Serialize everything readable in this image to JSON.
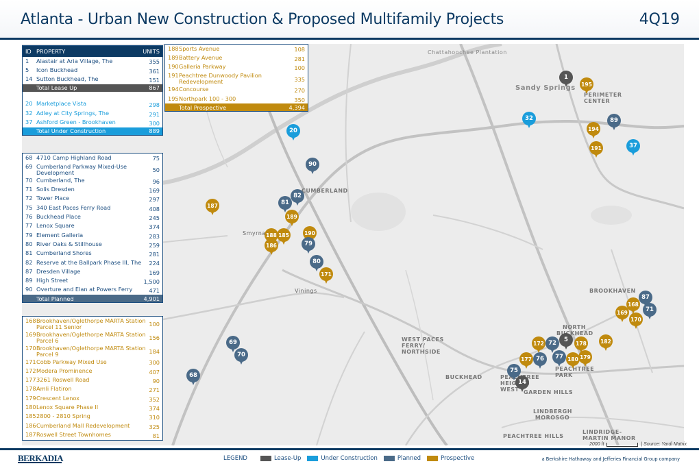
{
  "header": {
    "title": "Atlanta - Urban New Construction & Proposed Multifamily Projects",
    "quarter": "4Q19"
  },
  "table": {
    "columns": {
      "id": "ID",
      "property": "PROPERTY",
      "units": "UNITS"
    },
    "lease_up": {
      "rows": [
        {
          "id": "1",
          "name": "Alastair at Aria Village, The",
          "units": "355"
        },
        {
          "id": "5",
          "name": "Icon Buckhead",
          "units": "361"
        },
        {
          "id": "14",
          "name": "Sutton Buckhead, The",
          "units": "151"
        }
      ],
      "total_label": "Total Lease Up",
      "total": "867"
    },
    "under_construction": {
      "rows": [
        {
          "id": "20",
          "name": "Marketplace Vista",
          "units": "298"
        },
        {
          "id": "32",
          "name": "Adley at City Springs, The",
          "units": "291"
        },
        {
          "id": "37",
          "name": "Ashford Green - Brookhaven",
          "units": "300"
        }
      ],
      "total_label": "Total Under Construction",
      "total": "889"
    },
    "planned": {
      "rows": [
        {
          "id": "68",
          "name": "4710 Camp Highland Road",
          "units": "75"
        },
        {
          "id": "69",
          "name": "Cumberland Parkway Mixed-Use Development",
          "units": "50"
        },
        {
          "id": "70",
          "name": "Cumberland, The",
          "units": "96"
        },
        {
          "id": "71",
          "name": "Solis Dresden",
          "units": "169"
        },
        {
          "id": "72",
          "name": "Tower Place",
          "units": "297"
        },
        {
          "id": "75",
          "name": "340 East Paces Ferry Road",
          "units": "408"
        },
        {
          "id": "76",
          "name": "Buckhead Place",
          "units": "245"
        },
        {
          "id": "77",
          "name": "Lenox Square",
          "units": "374"
        },
        {
          "id": "79",
          "name": "Element Galleria",
          "units": "283"
        },
        {
          "id": "80",
          "name": "River Oaks & Stillhouse",
          "units": "259"
        },
        {
          "id": "81",
          "name": "Cumberland Shores",
          "units": "281"
        },
        {
          "id": "82",
          "name": "Reserve at the Ballpark Phase III, The",
          "units": "224"
        },
        {
          "id": "87",
          "name": "Dresden Village",
          "units": "169"
        },
        {
          "id": "89",
          "name": "High Street",
          "units": "1,500"
        },
        {
          "id": "90",
          "name": "Overture and Elan at Powers Ferry",
          "units": "471"
        }
      ],
      "total_label": "Total Planned",
      "total": "4,901"
    },
    "prospective": {
      "rows": [
        {
          "id": "168",
          "name": "Brookhaven/Oglethorpe MARTA Station Parcel 11 Senior",
          "units": "100"
        },
        {
          "id": "169",
          "name": "Brookhaven/Oglethorpe MARTA Station Parcel 6",
          "units": "156"
        },
        {
          "id": "170",
          "name": "Brookhaven/Oglethorpe MARTA Station Parcel 9",
          "units": "184"
        },
        {
          "id": "171",
          "name": "Cobb Parkway Mixed Use",
          "units": "300"
        },
        {
          "id": "172",
          "name": "Modera Prominence",
          "units": "407"
        },
        {
          "id": "177",
          "name": "3261 Roswell Road",
          "units": "90"
        },
        {
          "id": "178",
          "name": "Amli Flatiron",
          "units": "271"
        },
        {
          "id": "179",
          "name": "Crescent Lenox",
          "units": "352"
        },
        {
          "id": "180",
          "name": "Lenox Square Phase II",
          "units": "374"
        },
        {
          "id": "185",
          "name": "2800 - 2810 Spring",
          "units": "310"
        },
        {
          "id": "186",
          "name": "Cumberland Mall Redevelopment",
          "units": "325"
        },
        {
          "id": "187",
          "name": "Roswell Street Townhomes",
          "units": "81"
        }
      ]
    },
    "prospective_cont": {
      "rows": [
        {
          "id": "188",
          "name": "Sports Avenue",
          "units": "108"
        },
        {
          "id": "189",
          "name": "Battery Avenue",
          "units": "281"
        },
        {
          "id": "190",
          "name": "Galleria Parkway",
          "units": "100"
        },
        {
          "id": "191",
          "name": "Peachtree Dunwoody Pavilion Redevelopment",
          "units": "335"
        },
        {
          "id": "194",
          "name": "Concourse",
          "units": "270"
        },
        {
          "id": "195",
          "name": "Northpark 100 - 300",
          "units": "350"
        }
      ],
      "total_label": "Total Prospective",
      "total": "4,394"
    }
  },
  "map": {
    "labels": [
      {
        "text": "Chattahoochee Plantation"
      },
      {
        "text": "Sandy Springs"
      },
      {
        "text": "PERIMETER CENTER"
      },
      {
        "text": "CUMBERLAND"
      },
      {
        "text": "Smyrna"
      },
      {
        "text": "Vinings"
      },
      {
        "text": "BROOKHAVEN"
      },
      {
        "text": "NORTH BUCKHEAD"
      },
      {
        "text": "WEST PACES FERRY/ NORTHSIDE"
      },
      {
        "text": "PEACHTREE PARK"
      },
      {
        "text": "BUCKHEAD"
      },
      {
        "text": "PEACHTREE HEIGHTS WEST"
      },
      {
        "text": "GARDEN HILLS"
      },
      {
        "text": "LINDBERGH MOROSGO"
      },
      {
        "text": "PEACHTREE HILLS"
      },
      {
        "text": "LINDRIDGE-MARTIN MANOR"
      }
    ],
    "pins": [
      {
        "id": "1",
        "status": "lease"
      },
      {
        "id": "195",
        "status": "prospective"
      },
      {
        "id": "32",
        "status": "uc"
      },
      {
        "id": "89",
        "status": "planned"
      },
      {
        "id": "20",
        "status": "uc"
      },
      {
        "id": "194",
        "status": "prospective"
      },
      {
        "id": "191",
        "status": "prospective"
      },
      {
        "id": "37",
        "status": "uc"
      },
      {
        "id": "90",
        "status": "planned"
      },
      {
        "id": "82",
        "status": "planned"
      },
      {
        "id": "81",
        "status": "planned"
      },
      {
        "id": "187",
        "status": "prospective"
      },
      {
        "id": "189",
        "status": "prospective"
      },
      {
        "id": "190",
        "status": "prospective"
      },
      {
        "id": "188",
        "status": "prospective"
      },
      {
        "id": "185",
        "status": "prospective"
      },
      {
        "id": "79",
        "status": "planned"
      },
      {
        "id": "186",
        "status": "prospective"
      },
      {
        "id": "80",
        "status": "planned"
      },
      {
        "id": "171",
        "status": "prospective"
      },
      {
        "id": "168",
        "status": "prospective"
      },
      {
        "id": "87",
        "status": "planned"
      },
      {
        "id": "169",
        "status": "prospective"
      },
      {
        "id": "71",
        "status": "planned"
      },
      {
        "id": "170",
        "status": "prospective"
      },
      {
        "id": "69",
        "status": "planned"
      },
      {
        "id": "70",
        "status": "planned"
      },
      {
        "id": "172",
        "status": "prospective"
      },
      {
        "id": "72",
        "status": "planned"
      },
      {
        "id": "5",
        "status": "lease"
      },
      {
        "id": "178",
        "status": "prospective"
      },
      {
        "id": "182",
        "status": "prospective"
      },
      {
        "id": "177",
        "status": "prospective"
      },
      {
        "id": "76",
        "status": "planned"
      },
      {
        "id": "77",
        "status": "planned"
      },
      {
        "id": "180",
        "status": "prospective"
      },
      {
        "id": "179",
        "status": "prospective"
      },
      {
        "id": "75",
        "status": "planned"
      },
      {
        "id": "68",
        "status": "planned"
      },
      {
        "id": "14",
        "status": "lease"
      }
    ],
    "scale_text": "2000 ft",
    "source": "| Source: Yardi Matrix"
  },
  "footer": {
    "logo": "BERKADIA",
    "legend_title": "LEGEND",
    "legend": [
      {
        "label": "Lease-Up",
        "color": "#555555"
      },
      {
        "label": "Under Construction",
        "color": "#1a9ddb"
      },
      {
        "label": "Planned",
        "color": "#4a6a88"
      },
      {
        "label": "Prospective",
        "color": "#c08a0e"
      }
    ],
    "tagline": "a Berkshire Hathaway and Jefferies Financial Group company"
  },
  "colors": {
    "lease": "#555555",
    "uc": "#1a9ddb",
    "planned": "#4a6a88",
    "prospective": "#c08a0e",
    "navy": "#0d3a63"
  }
}
